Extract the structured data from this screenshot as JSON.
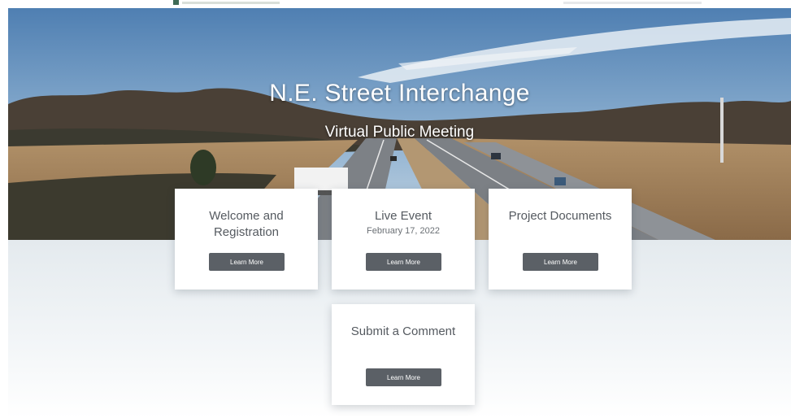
{
  "hero": {
    "title": "N.E. Street Interchange",
    "subtitle": "Virtual Public Meeting"
  },
  "cards": [
    {
      "title": "Welcome and Registration",
      "subtitle": "",
      "button_label": "Learn More"
    },
    {
      "title": "Live Event",
      "subtitle": "February 17, 2022",
      "button_label": "Learn More"
    },
    {
      "title": "Project Documents",
      "subtitle": "",
      "button_label": "Learn More"
    },
    {
      "title": "Submit a Comment",
      "subtitle": "",
      "button_label": "Learn More"
    }
  ],
  "colors": {
    "button_bg": "#5b6066",
    "card_bg": "#ffffff",
    "card_text": "#555a60",
    "page_bg": "#eef2f5"
  },
  "icons": [
    "site-logo-icon"
  ]
}
